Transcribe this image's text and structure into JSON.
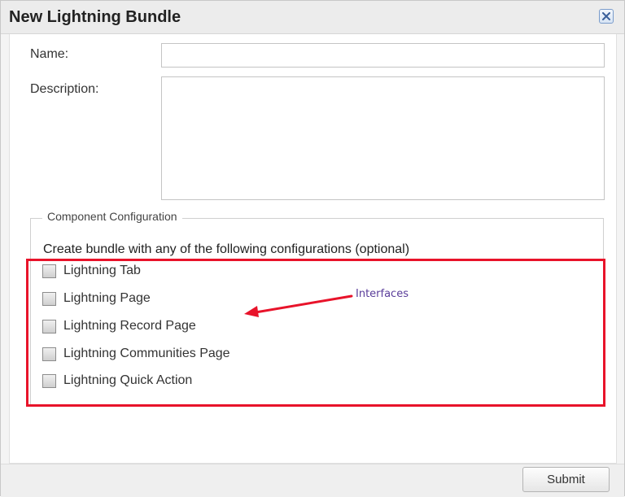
{
  "dialog": {
    "title": "New Lightning Bundle",
    "close_icon": "close-icon"
  },
  "form": {
    "name_label": "Name:",
    "name_value": "",
    "description_label": "Description:",
    "description_value": ""
  },
  "component_config": {
    "legend": "Component Configuration",
    "instructions": "Create bundle with any of the following configurations (optional)",
    "options": [
      {
        "label": "Lightning Tab",
        "checked": false
      },
      {
        "label": "Lightning Page",
        "checked": false
      },
      {
        "label": "Lightning Record Page",
        "checked": false
      },
      {
        "label": "Lightning Communities Page",
        "checked": false
      },
      {
        "label": "Lightning Quick Action",
        "checked": false
      }
    ]
  },
  "annotation": {
    "text": "Interfaces",
    "color": "#e8132a"
  },
  "footer": {
    "submit_label": "Submit"
  }
}
